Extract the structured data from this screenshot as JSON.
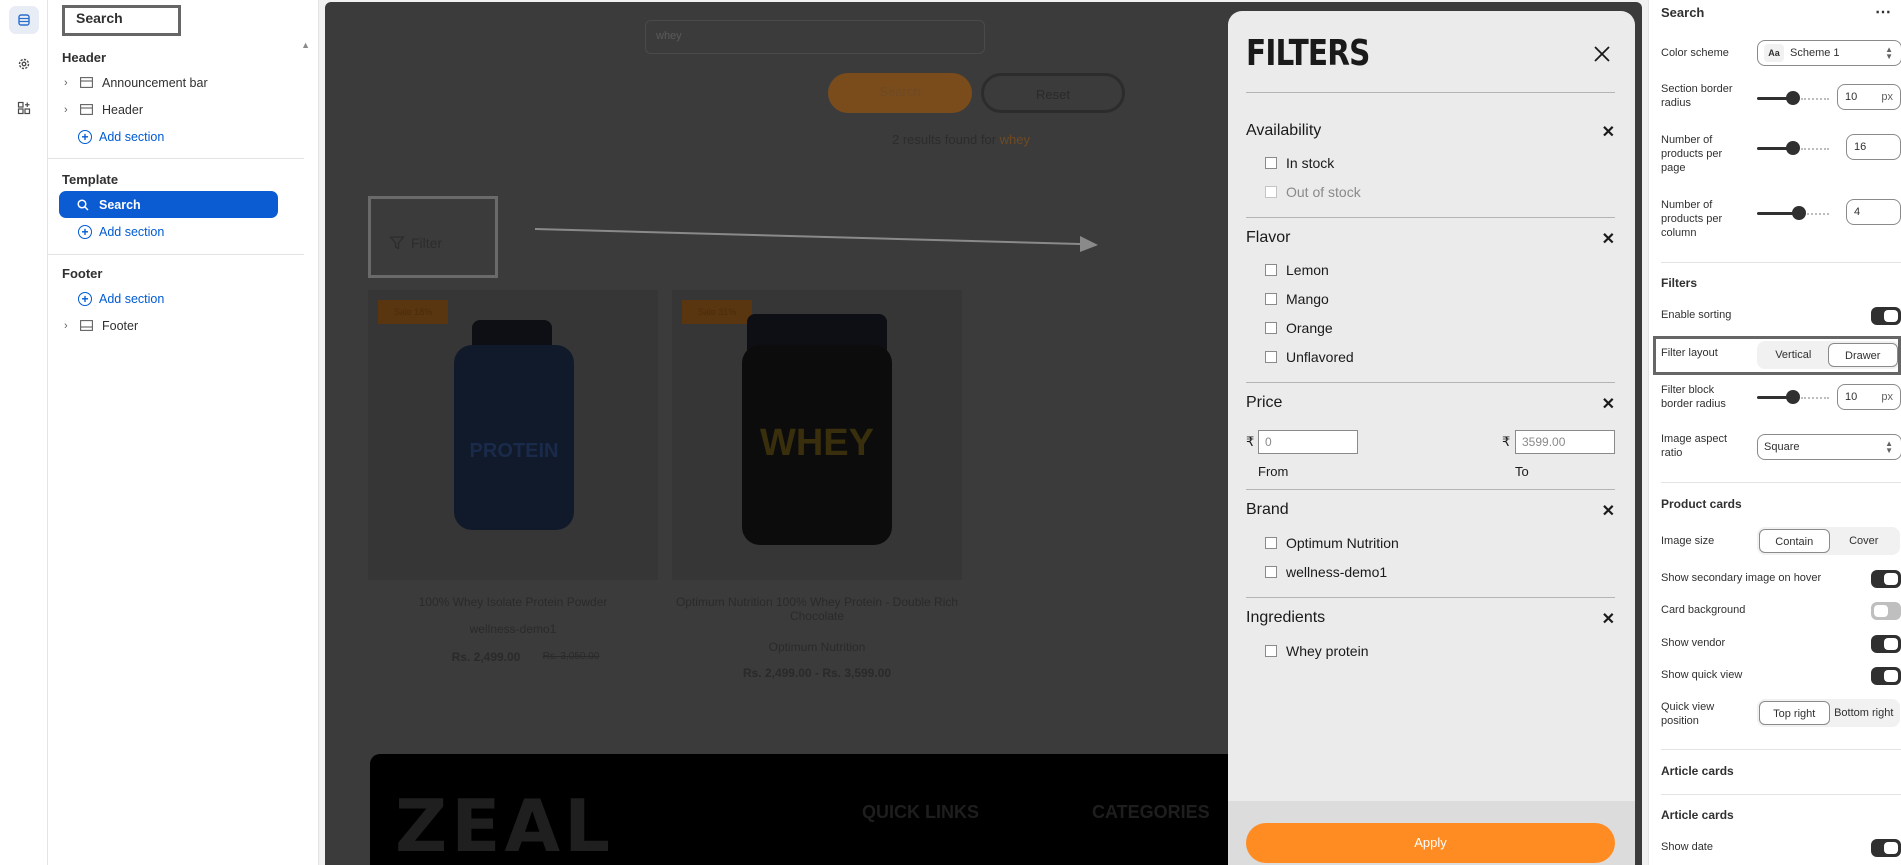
{
  "sidebar_rail": {
    "icons": [
      "sections-icon",
      "gear-icon",
      "apps-icon"
    ]
  },
  "tree": {
    "title": "Search",
    "header_group": {
      "title": "Header",
      "items": [
        "Announcement bar",
        "Header"
      ],
      "add_label": "Add section"
    },
    "template_group": {
      "title": "Template",
      "selected": "Search",
      "add_label": "Add section"
    },
    "footer_group": {
      "title": "Footer",
      "add_label": "Add section",
      "items": [
        "Footer"
      ]
    }
  },
  "preview": {
    "search_value": "whey",
    "search_button": "Search",
    "reset_button": "Reset",
    "results_prefix": "2 results found for ",
    "results_term": "whey",
    "filter_button": "Filter",
    "products": [
      {
        "badge": "Sale 18%",
        "label_art": "PROTEIN",
        "title": "100% Whey Isolate Protein Powder",
        "vendor": "wellness-demo1",
        "price": "Rs. 2,499.00",
        "compare": "Rs. 3,050.00"
      },
      {
        "badge": "Sale 31%",
        "label_art": "WHEY",
        "title": "Optimum Nutrition 100% Whey Protein - Double Rich Chocolate",
        "vendor": "Optimum Nutrition",
        "price": "Rs. 2,499.00 - Rs. 3,599.00",
        "compare": ""
      }
    ],
    "footer_logo": "ZEAL",
    "footer_cols": [
      "QUICK LINKS",
      "CATEGORIES"
    ]
  },
  "drawer": {
    "title": "FILTERS",
    "groups": {
      "availability": {
        "title": "Availability",
        "options": [
          "In stock",
          "Out of stock"
        ]
      },
      "flavor": {
        "title": "Flavor",
        "options": [
          "Lemon",
          "Mango",
          "Orange",
          "Unflavored"
        ]
      },
      "price": {
        "title": "Price",
        "currency": "₹",
        "from_placeholder": "0",
        "to_placeholder": "3599.00",
        "from_label": "From",
        "to_label": "To"
      },
      "brand": {
        "title": "Brand",
        "options": [
          "Optimum Nutrition",
          "wellness-demo1"
        ]
      },
      "ingredients": {
        "title": "Ingredients",
        "options": [
          "Whey protein"
        ]
      }
    },
    "apply": "Apply"
  },
  "settings": {
    "title": "Search",
    "color_scheme": {
      "label": "Color scheme",
      "badge": "Aa",
      "value": "Scheme 1"
    },
    "section_radius": {
      "label": "Section border radius",
      "value": "10",
      "unit": "px",
      "level": 0.5
    },
    "products_per_page": {
      "label": "Number of products per page",
      "value": "16",
      "level": 0.5
    },
    "products_per_column": {
      "label": "Number of products per column",
      "value": "4",
      "level": 0.58
    },
    "filters_heading": "Filters",
    "enable_sorting": {
      "label": "Enable sorting",
      "on": true
    },
    "filter_layout": {
      "label": "Filter layout",
      "options": [
        "Vertical",
        "Drawer"
      ],
      "selected": "Drawer"
    },
    "filter_radius": {
      "label": "Filter block border radius",
      "value": "10",
      "unit": "px",
      "level": 0.5
    },
    "aspect_ratio": {
      "label": "Image aspect ratio",
      "value": "Square"
    },
    "product_cards_heading": "Product cards",
    "image_size": {
      "label": "Image size",
      "options": [
        "Contain",
        "Cover"
      ],
      "selected": "Contain"
    },
    "secondary_hover": {
      "label": "Show secondary image on hover",
      "on": true
    },
    "card_background": {
      "label": "Card background",
      "on": false
    },
    "show_vendor": {
      "label": "Show vendor",
      "on": true
    },
    "quick_view": {
      "label": "Show quick view",
      "on": true
    },
    "quick_view_position": {
      "label": "Quick view position",
      "options": [
        "Top right",
        "Bottom right"
      ],
      "selected": "Top right"
    },
    "article_cards_heading_1": "Article cards",
    "article_cards_heading_2": "Article cards",
    "show_date": {
      "label": "Show date",
      "on": true
    }
  }
}
